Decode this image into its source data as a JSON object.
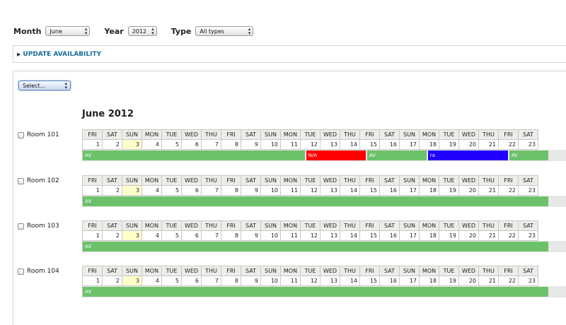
{
  "filters": {
    "month_label": "Month",
    "month_value": "June",
    "year_label": "Year",
    "year_value": "2012",
    "type_label": "Type",
    "type_value": "All types"
  },
  "update_link": "UPDATE AVAILABILITY",
  "panel_select": "Select...",
  "month_title": "June 2012",
  "days": [
    "FRI",
    "SAT",
    "SUN",
    "MON",
    "TUE",
    "WED",
    "THU",
    "FRI",
    "SAT",
    "SUN",
    "MON",
    "TUE",
    "WED",
    "THU",
    "FRI",
    "SAT",
    "SUN",
    "MON",
    "TUE",
    "WED",
    "THU",
    "FRI",
    "SAT"
  ],
  "dates": [
    "1",
    "2",
    "3",
    "4",
    "5",
    "6",
    "7",
    "8",
    "9",
    "10",
    "11",
    "12",
    "13",
    "14",
    "15",
    "16",
    "17",
    "18",
    "19",
    "20",
    "21",
    "22",
    "23"
  ],
  "highlight_date": "3",
  "colors": {
    "available": "#6cc26a",
    "na": "#ff0000",
    "ra": "#2200ff"
  },
  "rooms": [
    {
      "name": "Room 101",
      "segments": [
        {
          "label": "AV",
          "start": 1,
          "end": 11,
          "status": "available"
        },
        {
          "label": "N/A",
          "start": 12,
          "end": 14,
          "status": "na"
        },
        {
          "label": "AV",
          "start": 15,
          "end": 17,
          "status": "available"
        },
        {
          "label": "ra",
          "start": 18,
          "end": 21,
          "status": "ra"
        },
        {
          "label": "AV",
          "start": 22,
          "end": 23,
          "status": "available"
        }
      ]
    },
    {
      "name": "Room 102",
      "segments": [
        {
          "label": "AV",
          "start": 1,
          "end": 23,
          "status": "available"
        }
      ]
    },
    {
      "name": "Room 103",
      "segments": [
        {
          "label": "AV",
          "start": 1,
          "end": 23,
          "status": "available"
        }
      ]
    },
    {
      "name": "Room 104",
      "segments": [
        {
          "label": "AV",
          "start": 1,
          "end": 23,
          "status": "available"
        }
      ]
    }
  ]
}
